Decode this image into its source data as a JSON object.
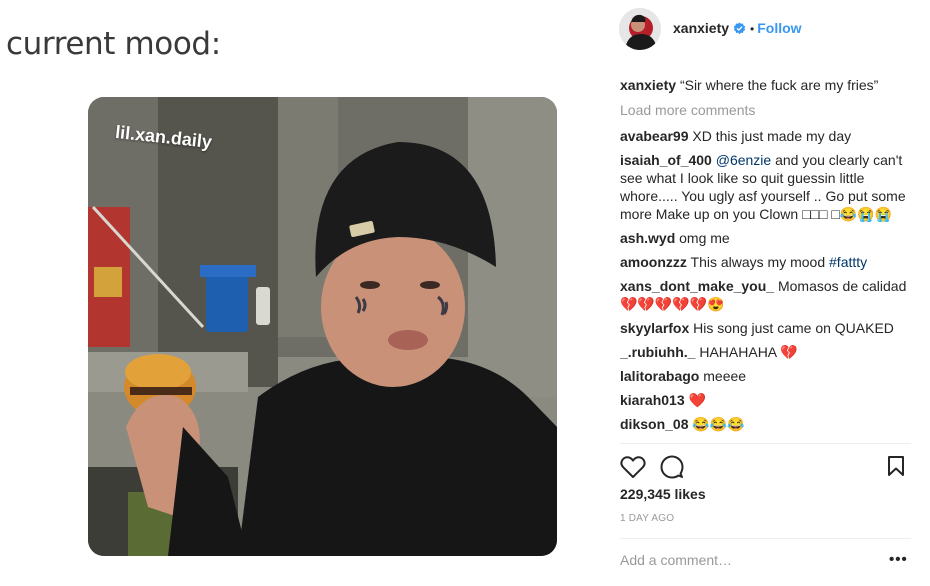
{
  "media": {
    "caption": "current mood:",
    "watermark": "lil.xan.daily"
  },
  "header": {
    "username": "xanxiety",
    "verified_icon": "verified-badge-icon",
    "separator": "•",
    "follow_label": "Follow"
  },
  "comments": {
    "caption": {
      "user": "xanxiety",
      "text": "“Sir where the fuck are my fries”"
    },
    "load_more": "Load more comments",
    "items": [
      {
        "user": "avabear99",
        "text": "XD this just made my day"
      },
      {
        "user": "isaiah_of_400",
        "mention": "@6enzie",
        "text": "and you clearly can't see what I look like so quit guessin little whore..... You ugly asf yourself .. Go put some more Make up on you Clown □□□ □😂😭😭"
      },
      {
        "user": "ash.wyd",
        "text": "omg me"
      },
      {
        "user": "amoonzzz",
        "text": "This always my mood",
        "hashtag": "#fattty"
      },
      {
        "user": "xans_dont_make_you_",
        "text": "Momasos de calidad 💔💔💔💔💔😍"
      },
      {
        "user": "skyylarfox",
        "text": "His song just came on QUAKED"
      },
      {
        "user": "_.rubiuhh._",
        "text": "HAHAHAHA 💔"
      },
      {
        "user": "lalitorabago",
        "text": "meeee"
      },
      {
        "user": "kiarah013",
        "text": "❤️"
      },
      {
        "user": "dikson_08",
        "text": "😂😂😂"
      }
    ]
  },
  "actions": {
    "like_icon": "heart-outline-icon",
    "comment_icon": "comment-bubble-icon",
    "save_icon": "bookmark-icon",
    "likes_text": "229,345 likes",
    "timestamp": "1 DAY AGO",
    "add_comment_placeholder": "Add a comment…",
    "more_label": "•••"
  },
  "colors": {
    "link_blue": "#3897f0",
    "hashtag_blue": "#003569",
    "muted_gray": "#999999",
    "heart_red": "#ed4956"
  }
}
